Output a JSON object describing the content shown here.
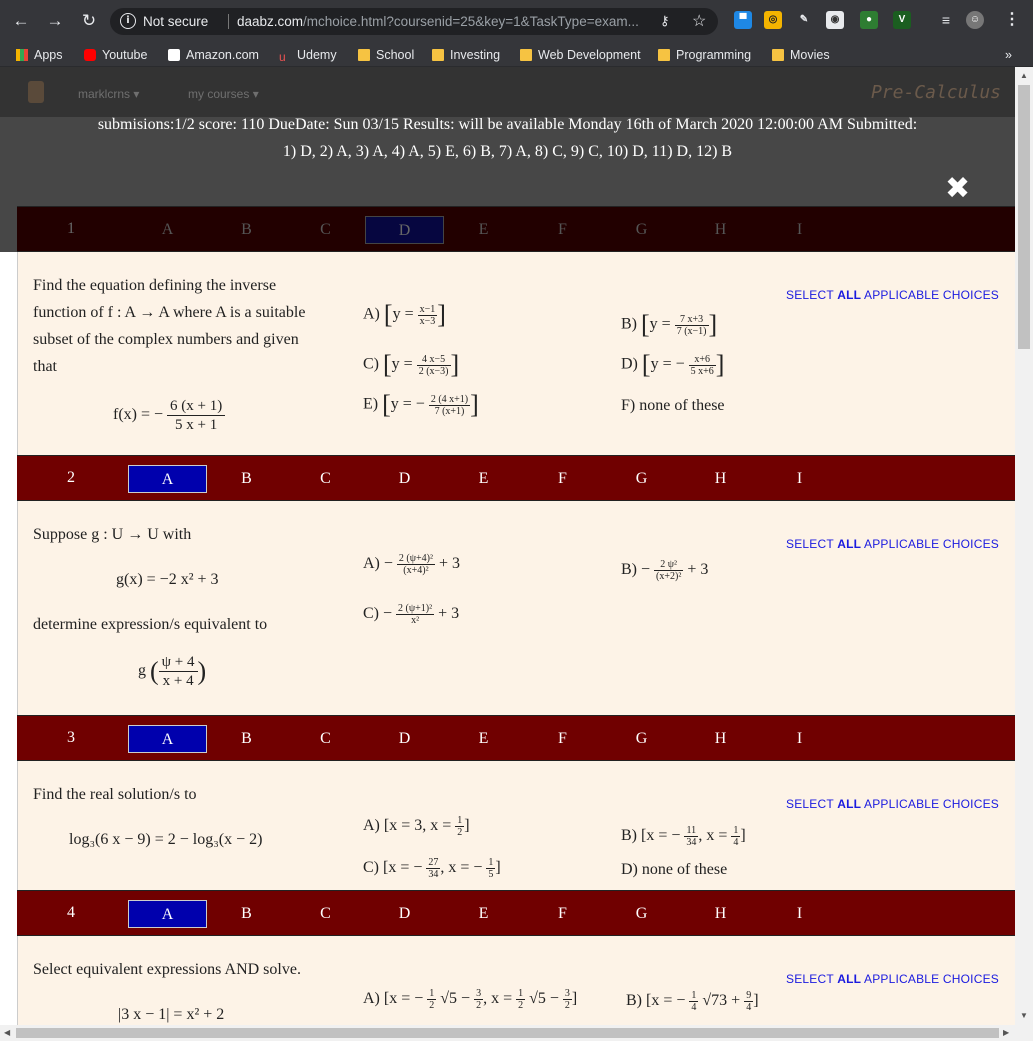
{
  "browser": {
    "not_secure": "Not secure",
    "url_host": "daabz.com",
    "url_path": "/mchoice.html?coursenid=25&key=1&TaskType=exam...",
    "bookmarks": [
      "Apps",
      "Youtube",
      "Amazon.com",
      "Udemy",
      "School",
      "Investing",
      "Web Development",
      "Programming",
      "Movies"
    ],
    "more": "»"
  },
  "site": {
    "user": "marklcrns",
    "courses": "my courses",
    "brand": "Pre-Calculus",
    "status": "submisions:1/2  score: 110  DueDate: Sun 03/15   Results: will be available Monday 16th of March 2020 12:00:00 AM   Submitted:",
    "answers": "1) D, 2) A, 3) A, 4) A, 5) E, 6) B, 7) A, 8) C, 9) C, 10) D, 11) D, 12) B",
    "close": "✖",
    "select_all": [
      "SELECT ",
      "ALL",
      " APPLICABLE CHOICES"
    ]
  },
  "options": [
    "A",
    "B",
    "C",
    "D",
    "E",
    "F",
    "G",
    "H",
    "I"
  ],
  "questions": [
    {
      "num": "1",
      "selected": "D",
      "prompt": "Find the equation defining the inverse function of f : A → A where A is a suitable subset of the complex numbers and given that",
      "fx": "f(x) = −"
    },
    {
      "num": "2",
      "selected": "A",
      "prompt1": "Suppose g : U → U with",
      "gx": "g(x) = −2 x² + 3",
      "prompt2": "determine expression/s equivalent to"
    },
    {
      "num": "3",
      "selected": "A",
      "prompt": "Find the real solution/s to",
      "eq": "log₃(6 x − 9) = 2 − log₃(x − 2)",
      "choiceD": "D) none of these"
    },
    {
      "num": "4",
      "selected": "A",
      "prompt": "Select equivalent expressions AND solve.",
      "eq": "|3 x − 1| = x² + 2"
    }
  ],
  "q1_choiceF": "F) none of these"
}
